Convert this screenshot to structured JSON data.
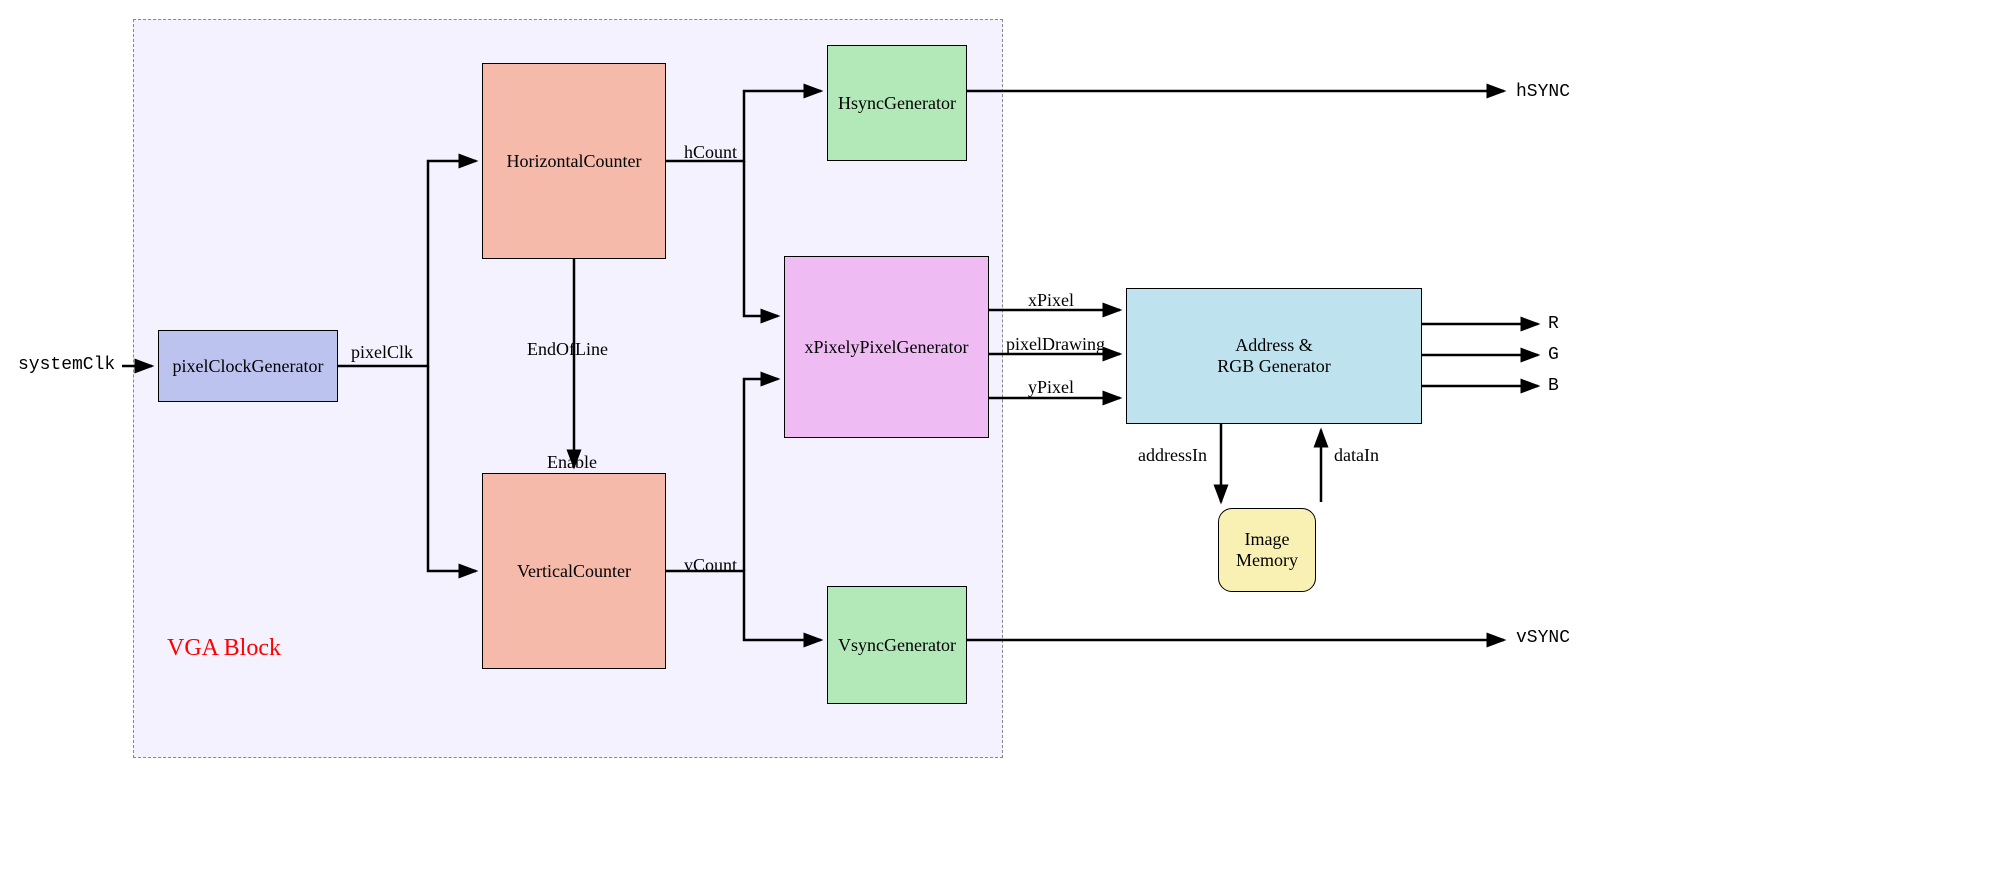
{
  "region": {
    "title": "VGA Block"
  },
  "inputs": {
    "systemClk": "systemClk"
  },
  "blocks": {
    "pixelClockGenerator": "pixelClockGenerator",
    "horizontalCounter": "HorizontalCounter",
    "verticalCounter": "VerticalCounter",
    "hsyncGenerator": "HsyncGenerator",
    "vsyncGenerator": "VsyncGenerator",
    "xPixelGenerator": "xPixelyPixelGenerator",
    "addressRgbGenerator_line1": "Address &",
    "addressRgbGenerator_line2": "RGB Generator",
    "imageMemory_line1": "Image",
    "imageMemory_line2": "Memory"
  },
  "signals": {
    "pixelClk": "pixelClk",
    "endOfLine": "EndOfLine",
    "enable": "Enable",
    "hCount": "hCount",
    "vCount": "vCount",
    "xPixel": "xPixel",
    "yPixel": "yPixel",
    "pixelDrawing": "pixelDrawing",
    "addressIn": "addressIn",
    "dataIn": "dataIn"
  },
  "outputs": {
    "hSYNC": "hSYNC",
    "vSYNC": "vSYNC",
    "R": "R",
    "G": "G",
    "B": "B"
  },
  "colors": {
    "vgaRegionFill": "#e7e5fc",
    "pixelClockFill": "#bdc3ef",
    "counterFill": "#f6baab",
    "syncFill": "#b3e9b8",
    "xPixelFill": "#eebbf3",
    "addressFill": "#bee3ef",
    "memoryFill": "#f9f1b4",
    "titleColor": "#ff0000"
  }
}
